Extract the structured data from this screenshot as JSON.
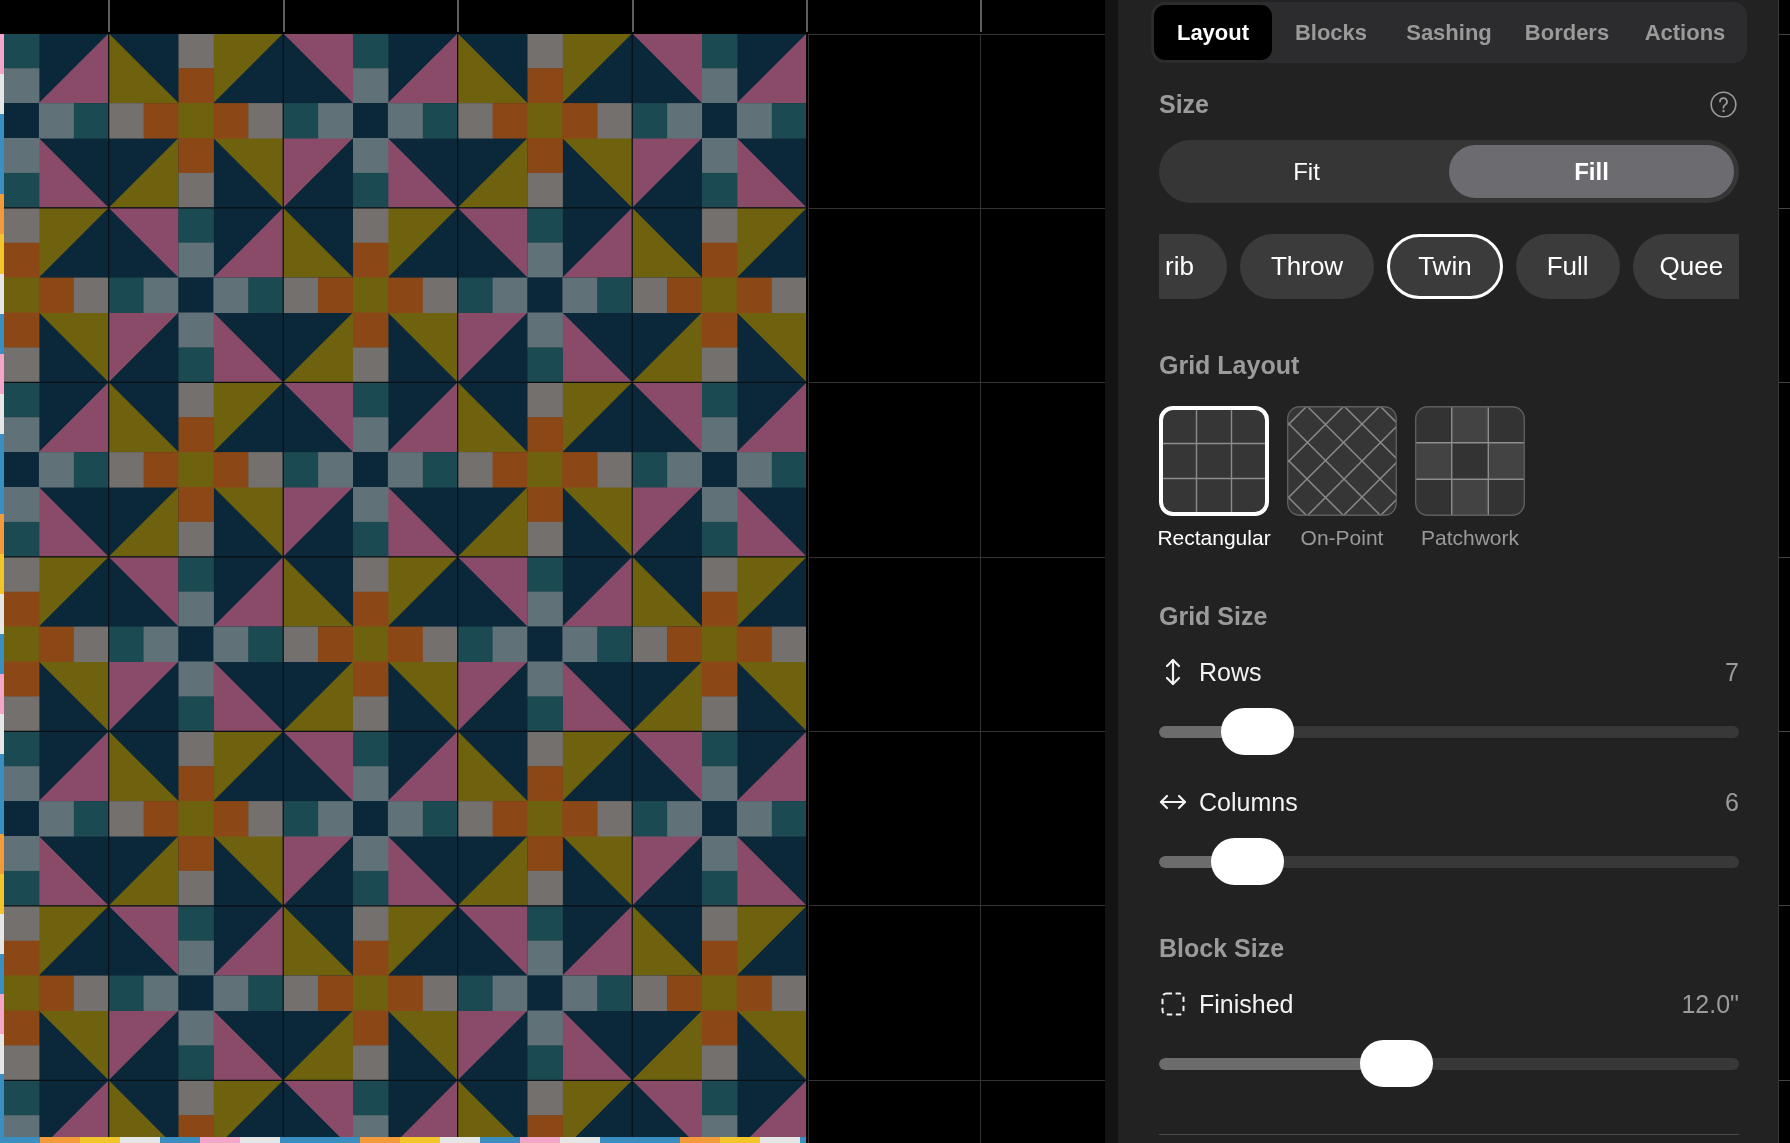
{
  "tabs": [
    {
      "label": "Layout",
      "selected": true
    },
    {
      "label": "Blocks",
      "selected": false
    },
    {
      "label": "Sashing",
      "selected": false
    },
    {
      "label": "Borders",
      "selected": false
    },
    {
      "label": "Actions",
      "selected": false
    }
  ],
  "size": {
    "title": "Size",
    "modes": [
      {
        "label": "Fit",
        "selected": false
      },
      {
        "label": "Fill",
        "selected": true
      }
    ],
    "presets": [
      {
        "label": "rib",
        "selected": false
      },
      {
        "label": "Throw",
        "selected": false
      },
      {
        "label": "Twin",
        "selected": true
      },
      {
        "label": "Full",
        "selected": false
      },
      {
        "label": "Quee",
        "selected": false
      }
    ]
  },
  "grid_layout": {
    "title": "Grid Layout",
    "options": [
      {
        "label": "Rectangular",
        "kind": "rectangular",
        "selected": true
      },
      {
        "label": "On-Point",
        "kind": "on_point",
        "selected": false
      },
      {
        "label": "Patchwork",
        "kind": "patchwork",
        "selected": false
      }
    ]
  },
  "grid_size": {
    "title": "Grid Size",
    "controls": [
      {
        "label": "Rows",
        "kind": "vertical",
        "value": "7",
        "level": 0.17
      },
      {
        "label": "Columns",
        "kind": "horizontal",
        "value": "6",
        "level": 0.152
      }
    ]
  },
  "block_size": {
    "title": "Block Size",
    "controls": [
      {
        "label": "Finished",
        "kind": "dashed_square",
        "value": "12.0\"",
        "level": 0.41
      }
    ]
  }
}
